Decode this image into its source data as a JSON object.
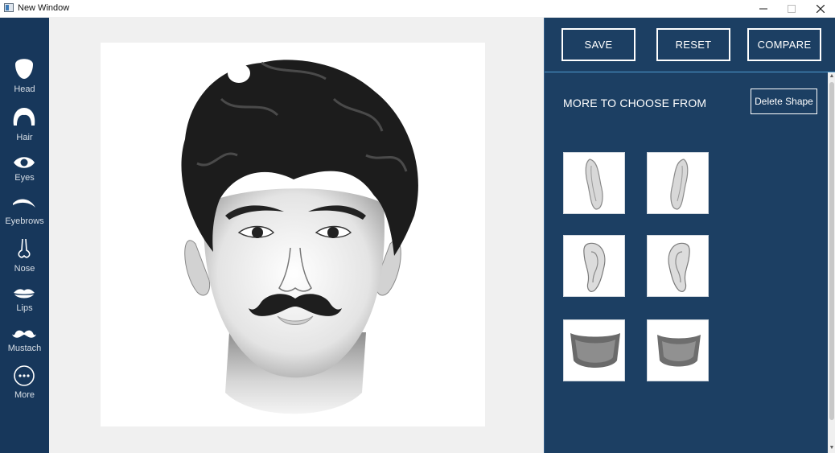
{
  "window": {
    "title": "New Window",
    "controls": {
      "minimize": "–",
      "maximize": "□",
      "close": "✕"
    }
  },
  "sidebar": {
    "items": [
      {
        "label": "Head",
        "icon": "head-icon"
      },
      {
        "label": "Hair",
        "icon": "hair-icon"
      },
      {
        "label": "Eyes",
        "icon": "eye-icon"
      },
      {
        "label": "Eyebrows",
        "icon": "eyebrow-icon"
      },
      {
        "label": "Nose",
        "icon": "nose-icon"
      },
      {
        "label": "Lips",
        "icon": "lips-icon"
      },
      {
        "label": "Mustach",
        "icon": "mustache-icon"
      },
      {
        "label": "More",
        "icon": "more-icon"
      }
    ]
  },
  "toolbar": {
    "save_label": "SAVE",
    "reset_label": "RESET",
    "compare_label": "COMPARE"
  },
  "panel": {
    "title": "MORE TO CHOOSE FROM",
    "delete_label": "Delete Shape",
    "shapes": [
      {
        "name": "left-ear-side"
      },
      {
        "name": "right-ear-side"
      },
      {
        "name": "left-ear-front"
      },
      {
        "name": "right-ear-front"
      },
      {
        "name": "neck-left"
      },
      {
        "name": "neck-right"
      }
    ]
  },
  "colors": {
    "sidebar": "#17375b",
    "panel": "#1c3f63",
    "accent_line": "#4f9bd0"
  }
}
